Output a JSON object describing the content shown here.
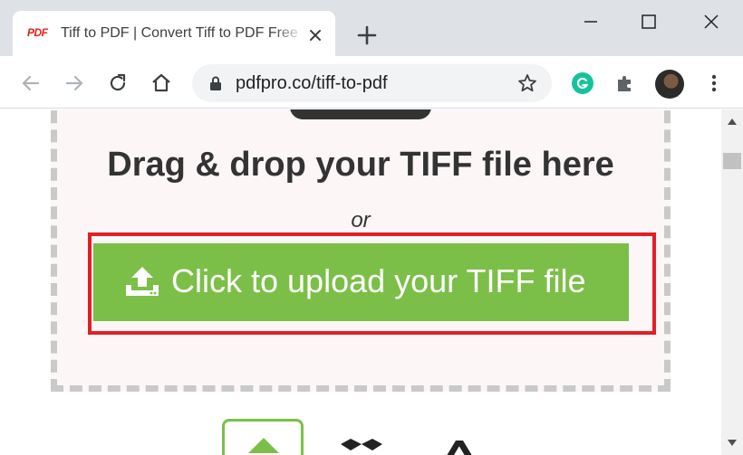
{
  "browser": {
    "tab": {
      "favicon_text": "PDF",
      "title": "Tiff to PDF | Convert Tiff to PDF Free"
    },
    "address_bar": {
      "url": "pdfpro.co/tiff-to-pdf"
    },
    "icons": {
      "back": "back-arrow-icon",
      "forward": "forward-arrow-icon",
      "reload": "reload-icon",
      "home": "home-icon",
      "lock": "lock-icon",
      "bookmark": "star-icon",
      "grammarly": "grammarly-icon",
      "extensions": "puzzle-icon",
      "profile": "avatar",
      "menu": "kebab-menu-icon",
      "new_tab": "plus-icon",
      "minimize": "minimize-icon",
      "maximize": "maximize-icon",
      "close": "close-icon"
    }
  },
  "page": {
    "dropzone": {
      "heading": "Drag & drop your TIFF file here",
      "or_text": "or",
      "upload_button_label": "Click to upload your TIFF file",
      "upload_icon": "upload-icon"
    },
    "sources": [
      "upload-from-device-icon",
      "dropbox-icon",
      "google-drive-icon"
    ]
  },
  "colors": {
    "upload_green": "#7cbf48",
    "highlight_red": "#e21f26",
    "dropzone_bg": "#fcf6f7",
    "heading_text": "#333333",
    "favicon_red": "#e2231a"
  }
}
